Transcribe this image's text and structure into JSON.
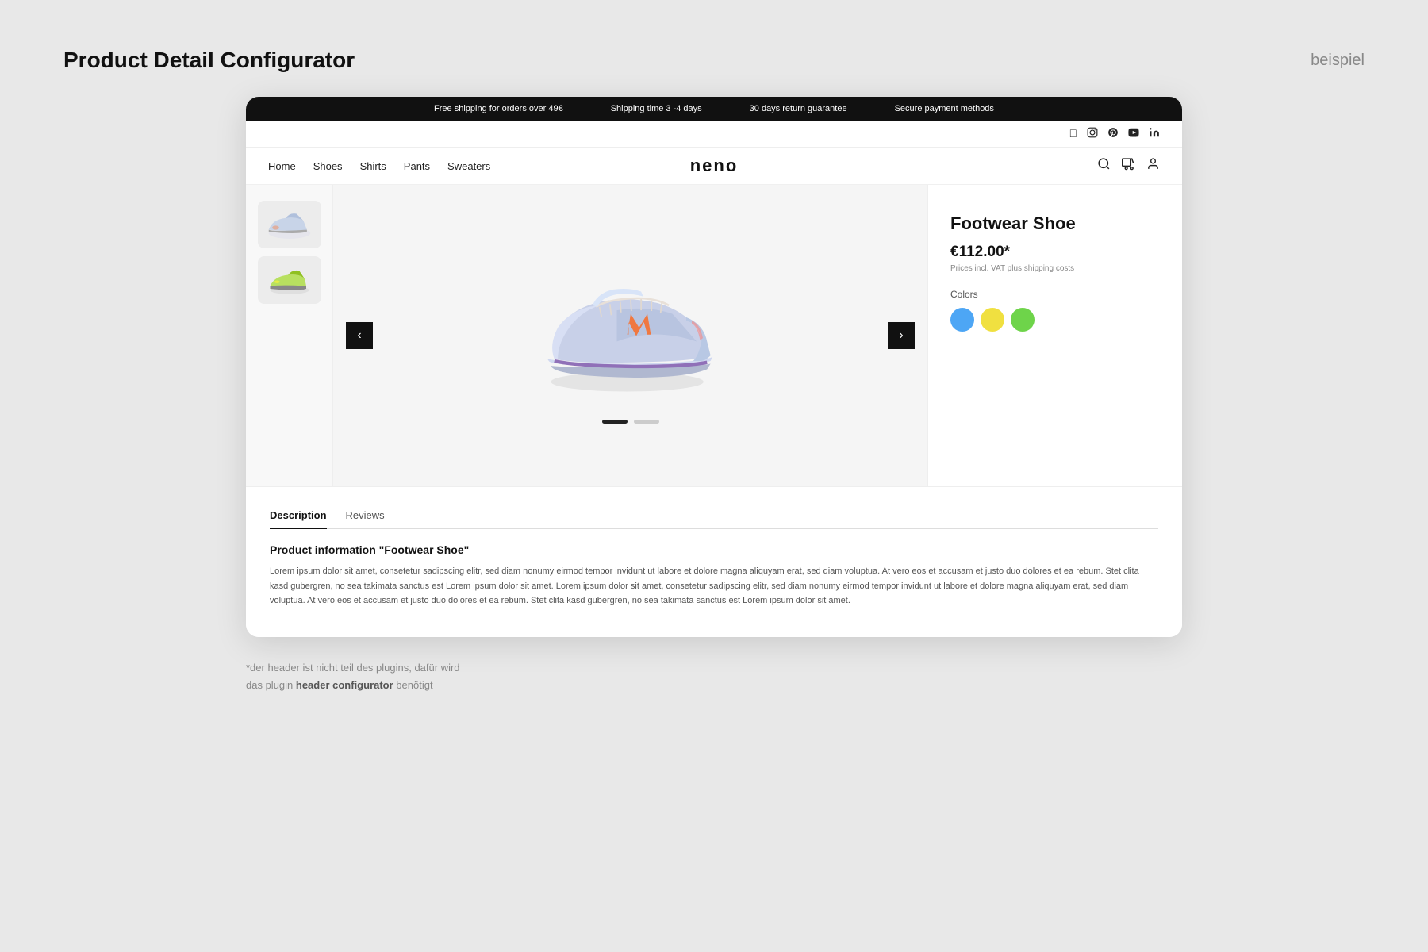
{
  "page": {
    "title": "Product Detail Configurator",
    "brand": "beispiel"
  },
  "announcement_bar": {
    "items": [
      "Free shipping for orders over 49€",
      "Shipping time 3 -4 days",
      "30 days return guarantee",
      "Secure payment methods"
    ]
  },
  "social_icons": [
    "facebook",
    "instagram",
    "pinterest",
    "youtube",
    "linkedin"
  ],
  "nav": {
    "links": [
      "Home",
      "Shoes",
      "Shirts",
      "Pants",
      "Sweaters"
    ],
    "logo": "neno"
  },
  "product": {
    "name": "Footwear Shoe",
    "price": "€112.00*",
    "vat_note": "Prices incl. VAT plus shipping costs",
    "colors_label": "Colors",
    "colors": [
      "blue",
      "yellow",
      "green"
    ]
  },
  "tabs": {
    "items": [
      "Description",
      "Reviews"
    ],
    "active": "Description"
  },
  "description": {
    "heading": "Product information \"Footwear Shoe\"",
    "text": "Lorem ipsum dolor sit amet, consetetur sadipscing elitr, sed diam nonumy eirmod tempor invidunt ut labore et dolore magna aliquyam erat, sed diam voluptua. At vero eos et accusam et justo duo dolores et ea rebum. Stet clita kasd gubergren, no sea takimata sanctus est Lorem ipsum dolor sit amet. Lorem ipsum dolor sit amet, consetetur sadipscing elitr, sed diam nonumy eirmod tempor invidunt ut labore et dolore magna aliquyam erat, sed diam voluptua. At vero eos et accusam et justo duo dolores et ea rebum. Stet clita kasd gubergren, no sea takimata sanctus est Lorem ipsum dolor sit amet."
  },
  "footer_note": {
    "line1": "*der header ist nicht teil des plugins, dafür wird",
    "line2_pre": "das plugin ",
    "line2_bold": "header configurator",
    "line2_post": " benötigt"
  },
  "carousel": {
    "prev_label": "‹",
    "next_label": "›",
    "dot_count": 2,
    "active_dot": 0
  }
}
